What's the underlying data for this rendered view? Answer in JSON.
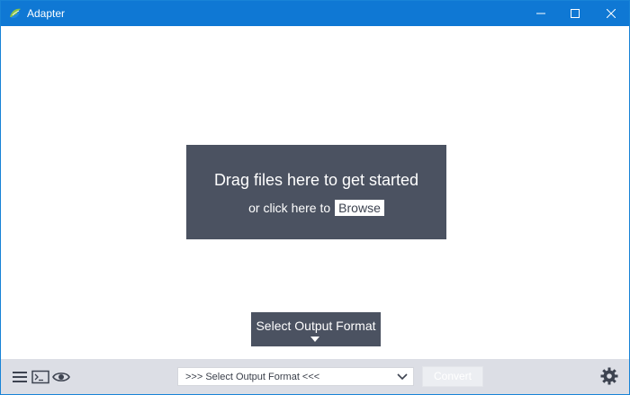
{
  "window": {
    "title": "Adapter",
    "app_icon": "adapter-logo-icon",
    "controls": {
      "minimize_icon": "minimize-icon",
      "maximize_icon": "maximize-icon",
      "close_icon": "close-icon"
    }
  },
  "dropzone": {
    "title": "Drag files here to get started",
    "subtitle": "or click here to",
    "browse_label": "Browse"
  },
  "format_popup": {
    "label": "Select Output Format",
    "caret_icon": "caret-down-icon"
  },
  "toolbar": {
    "menu_icon": "hamburger-menu-icon",
    "console_icon": "console-icon",
    "preview_icon": "eye-icon",
    "settings_icon": "gear-icon",
    "format_select": {
      "selected": ">>> Select Output Format <<<",
      "chevron_icon": "chevron-down-icon"
    },
    "convert_label": "Convert"
  },
  "colors": {
    "titlebar": "#0f78d4",
    "panel": "#4b5261",
    "toolbar": "#dcdee5",
    "convert_disabled": "#eceef2"
  }
}
